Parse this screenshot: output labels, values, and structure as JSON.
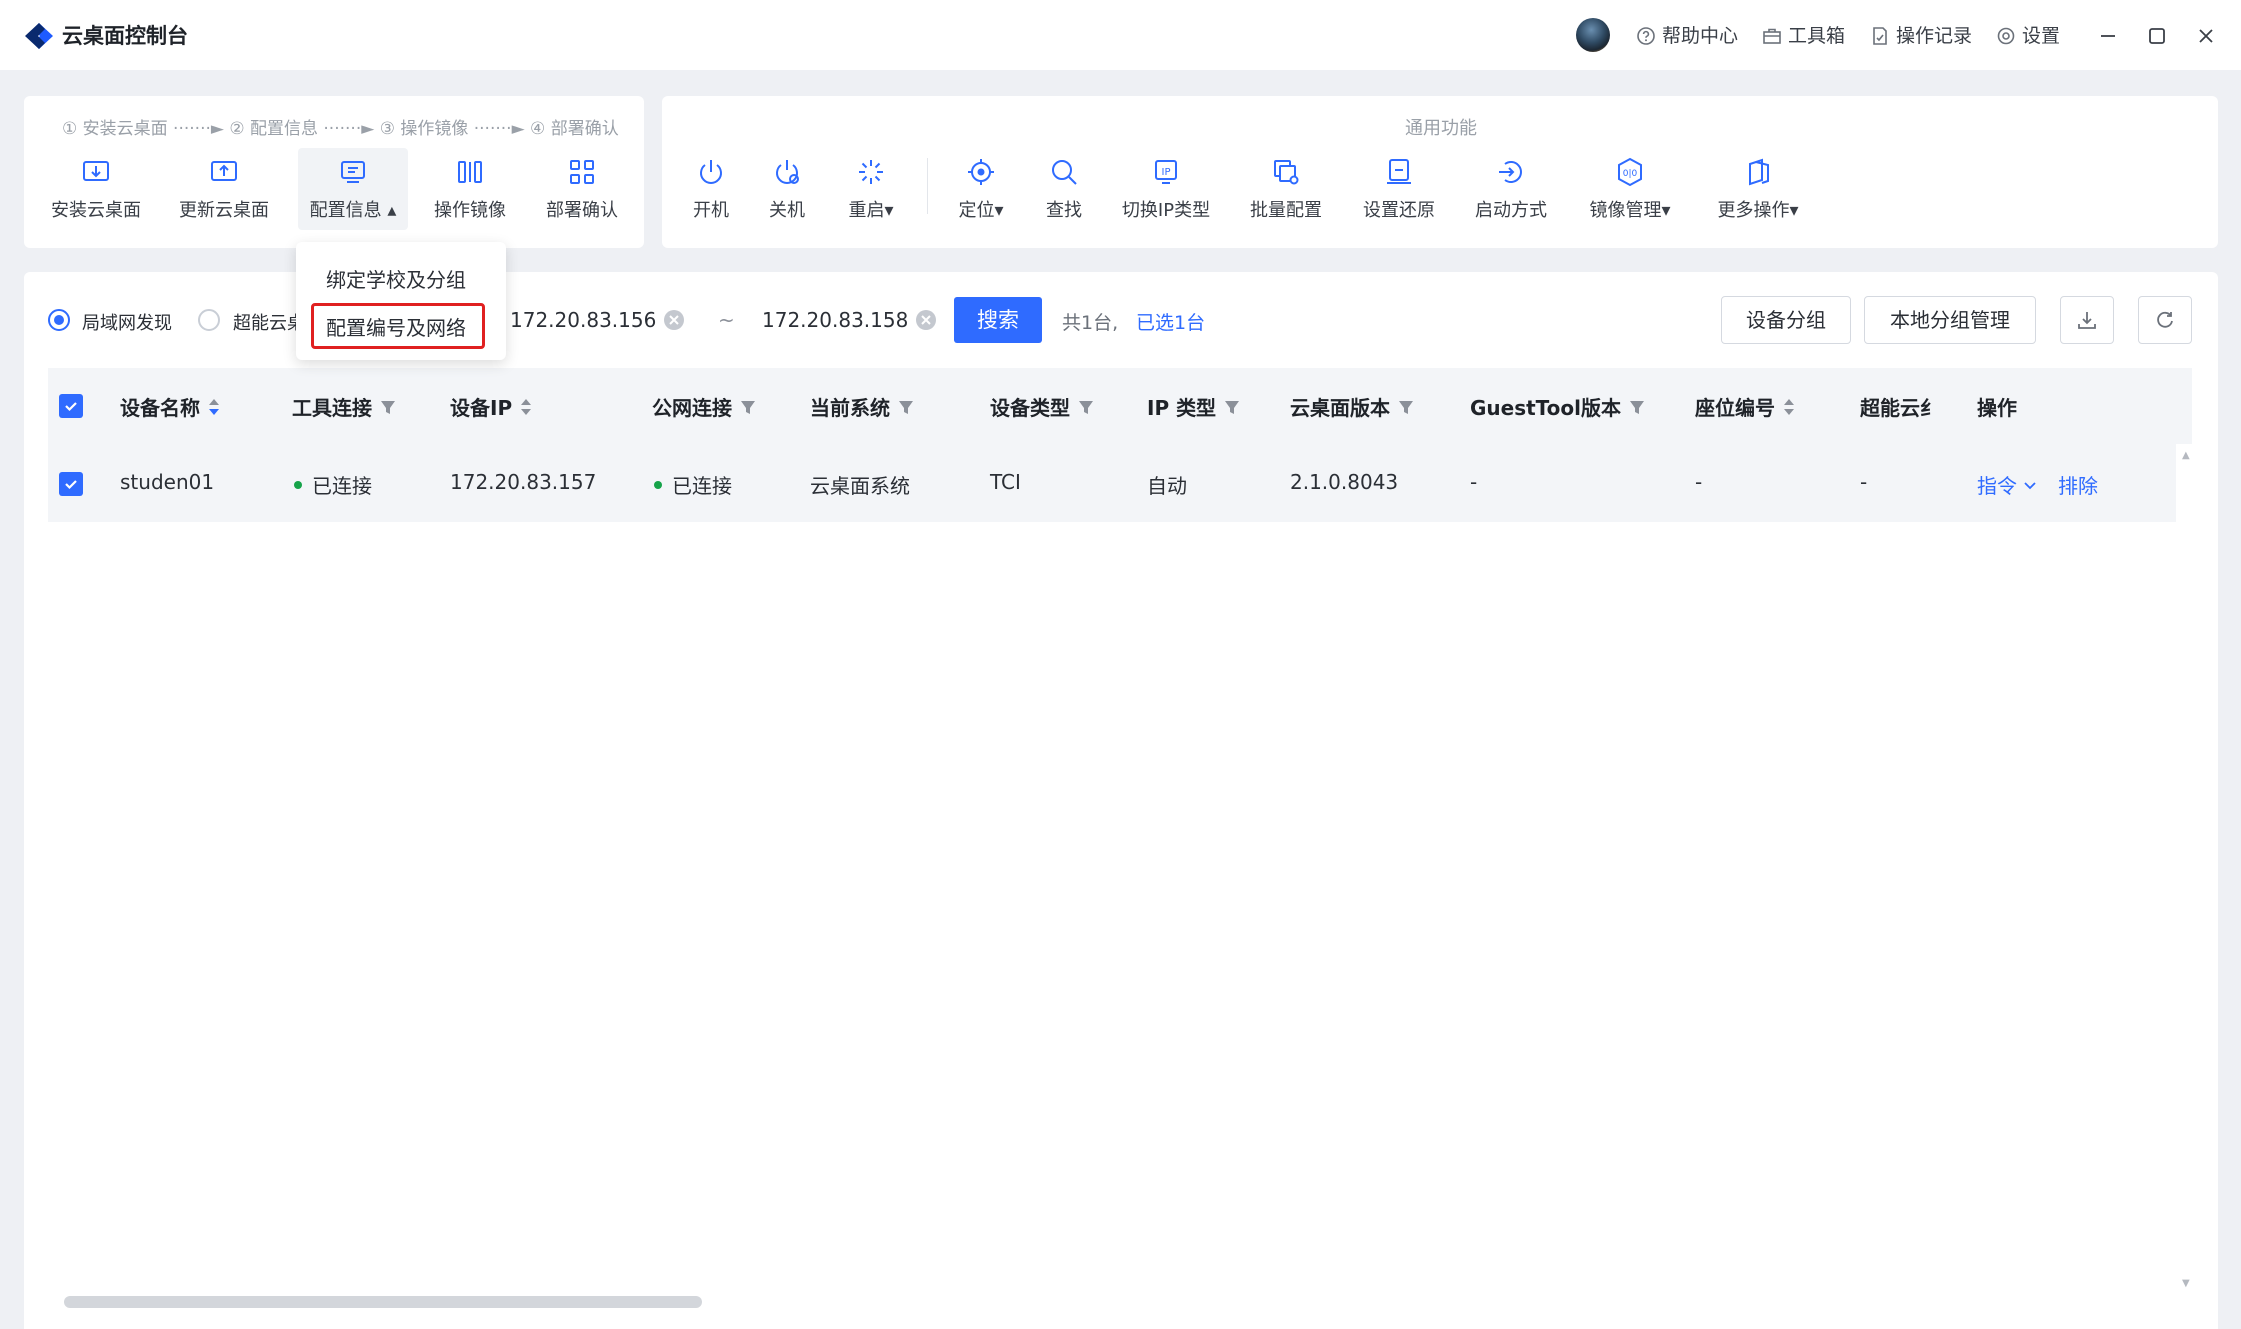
{
  "app": {
    "title": "云桌面控制台"
  },
  "titlebar": {
    "help": "帮助中心",
    "toolbox": "工具箱",
    "oplog": "操作记录",
    "settings": "设置"
  },
  "wizard": {
    "steps": "① 安装云桌面 ·······► ② 配置信息 ·······► ③ 操作镜像 ·······► ④ 部署确认",
    "tools": [
      "安装云桌面",
      "更新云桌面",
      "配置信息",
      "操作镜像",
      "部署确认"
    ]
  },
  "common": {
    "title": "通用功能",
    "tools": [
      "开机",
      "关机",
      "重启",
      "定位",
      "查找",
      "切换IP类型",
      "批量配置",
      "设置还原",
      "启动方式",
      "镜像管理",
      "更多操作"
    ]
  },
  "dropdown": {
    "items": [
      "绑定学校及分组",
      "配置编号及网络"
    ]
  },
  "filter": {
    "lan_discovery": "局域网发现",
    "super_cloud": "超能云桌",
    "ip_from": "172.20.83.156",
    "ip_sep": "~",
    "ip_to": "172.20.83.158",
    "search": "搜索",
    "total": "共1台,",
    "selected": "已选1台",
    "device_group": "设备分组",
    "local_group": "本地分组管理"
  },
  "table": {
    "columns": [
      "设备名称",
      "工具连接",
      "设备IP",
      "公网连接",
      "当前系统",
      "设备类型",
      "IP 类型",
      "云桌面版本",
      "GuestTool版本",
      "座位编号",
      "超能云纟",
      "操作"
    ],
    "rows": [
      {
        "name": "studen01",
        "tool_conn": "已连接",
        "ip": "172.20.83.157",
        "public_conn": "已连接",
        "system": "云桌面系统",
        "device_type": "TCI",
        "ip_type": "自动",
        "version": "2.1.0.8043",
        "guesttool": "-",
        "seat": "-",
        "super": "-",
        "action_cmd": "指令",
        "action_exclude": "排除"
      }
    ]
  },
  "colors": {
    "accent": "#2f6bff",
    "connected": "#16a34a",
    "highlight": "#e02020"
  }
}
